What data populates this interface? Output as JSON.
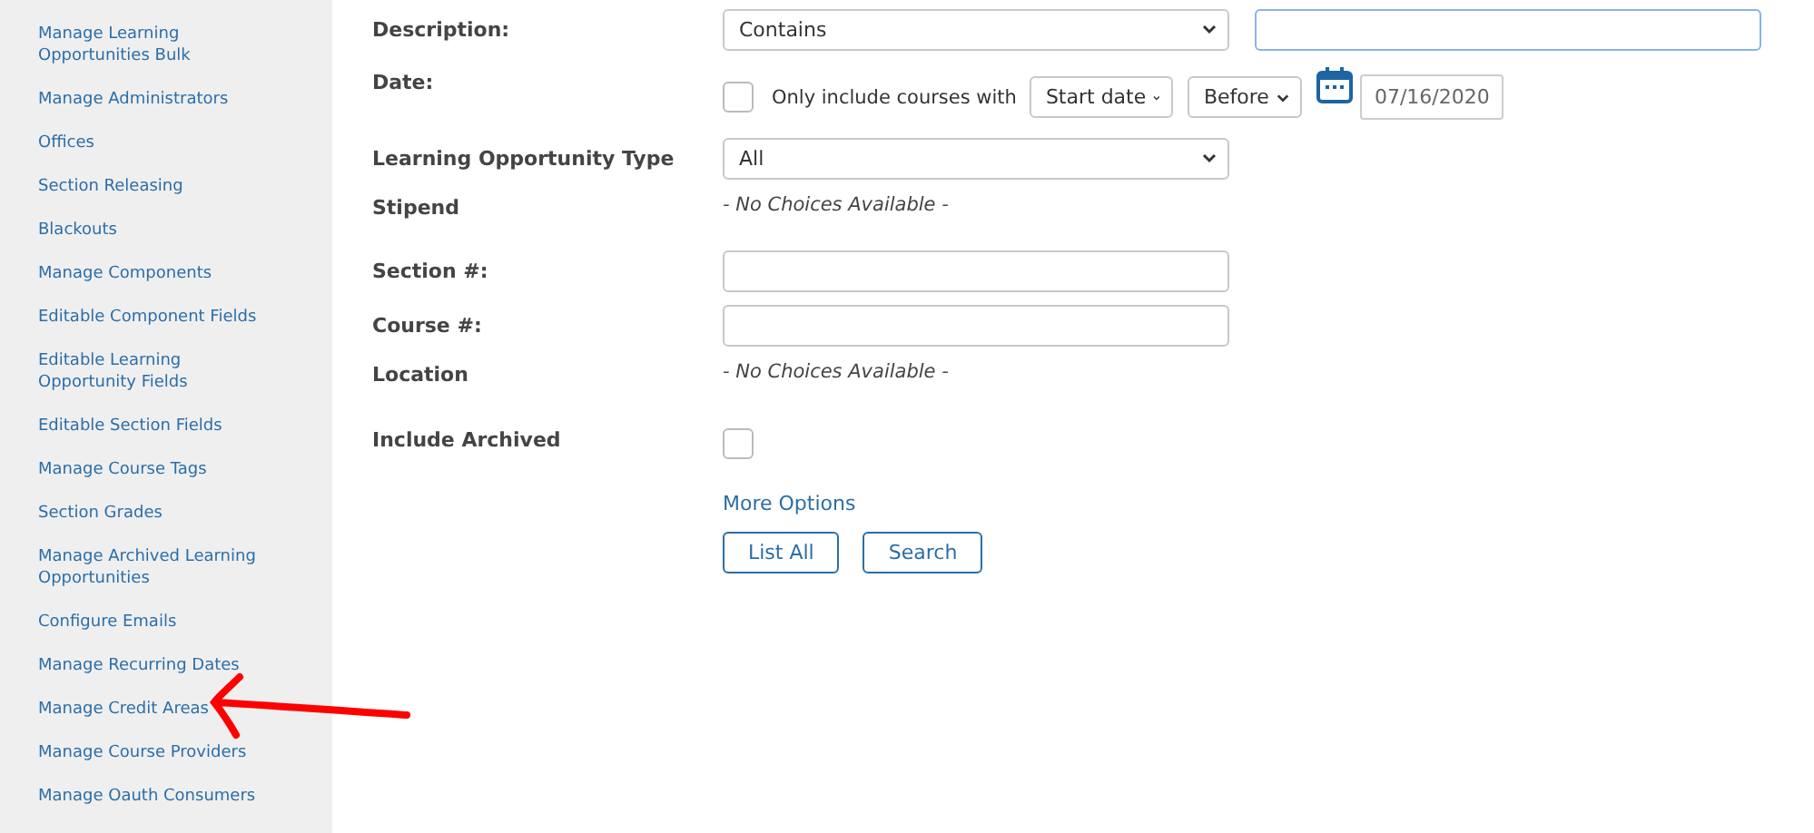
{
  "sidebar": {
    "items": [
      {
        "label": "Manage Learning Opportunities Bulk"
      },
      {
        "label": "Manage Administrators"
      },
      {
        "label": "Offices"
      },
      {
        "label": "Section Releasing"
      },
      {
        "label": "Blackouts"
      },
      {
        "label": "Manage Components"
      },
      {
        "label": "Editable Component Fields"
      },
      {
        "label": "Editable Learning Opportunity Fields"
      },
      {
        "label": "Editable Section Fields"
      },
      {
        "label": "Manage Course Tags"
      },
      {
        "label": "Section Grades"
      },
      {
        "label": "Manage Archived Learning Opportunities"
      },
      {
        "label": "Configure Emails"
      },
      {
        "label": "Manage Recurring Dates"
      },
      {
        "label": "Manage Credit Areas"
      },
      {
        "label": "Manage Course Providers"
      },
      {
        "label": "Manage Oauth Consumers"
      }
    ]
  },
  "form": {
    "fields": [
      {
        "kind": "select_input",
        "label": "Description:",
        "select": "Contains",
        "focused": true
      },
      {
        "kind": "date",
        "label": "Date:",
        "checked": false,
        "text": "Only include courses with",
        "selects": [
          "Start date",
          "Before"
        ],
        "date": "07/16/2020"
      },
      {
        "kind": "select",
        "label": "Learning Opportunity Type",
        "select": "All"
      },
      {
        "kind": "note",
        "label": "Stipend",
        "note": "- No Choices Available -"
      },
      {
        "kind": "input",
        "label": "Section #:"
      },
      {
        "kind": "input",
        "label": "Course #:"
      },
      {
        "kind": "note",
        "label": "Location",
        "note": "- No Choices Available -"
      },
      {
        "kind": "checkbox",
        "label": "Include Archived",
        "checked": false
      }
    ],
    "link": "More Options",
    "buttons": [
      "List All",
      "Search"
    ]
  }
}
